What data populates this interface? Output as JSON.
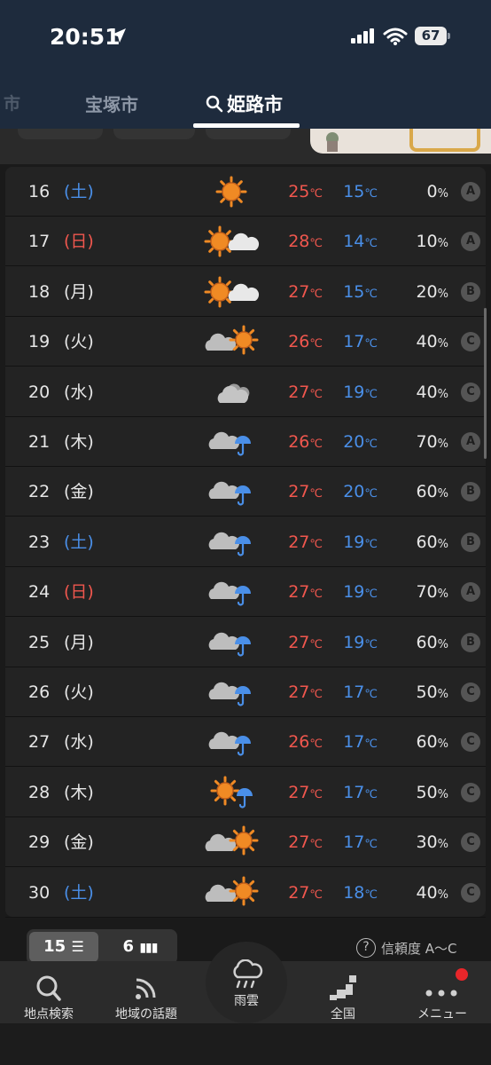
{
  "status_bar": {
    "time": "20:51",
    "battery": "67"
  },
  "tabs": {
    "prev_partial": "市",
    "other": "宝塚市",
    "active": "姫路市"
  },
  "colors": {
    "high": "#f0574e",
    "low": "#4a8fe8",
    "sun": "#f08a24",
    "rain": "#4a8fe8"
  },
  "forecast": [
    {
      "date": "16",
      "weekday": "(土)",
      "day_type": "sat",
      "icon": "sunny-icon",
      "high": "25",
      "low": "15",
      "unit": "℃",
      "pop": "0",
      "pct": "%",
      "reliability": "A"
    },
    {
      "date": "17",
      "weekday": "(日)",
      "day_type": "sun",
      "icon": "sunny-then-cloudy-icon",
      "high": "28",
      "low": "14",
      "unit": "℃",
      "pop": "10",
      "pct": "%",
      "reliability": "A"
    },
    {
      "date": "18",
      "weekday": "(月)",
      "day_type": "wkd",
      "icon": "sunny-then-cloudy-icon",
      "high": "27",
      "low": "15",
      "unit": "℃",
      "pop": "20",
      "pct": "%",
      "reliability": "B"
    },
    {
      "date": "19",
      "weekday": "(火)",
      "day_type": "wkd",
      "icon": "cloudy-then-sunny-icon",
      "high": "26",
      "low": "17",
      "unit": "℃",
      "pop": "40",
      "pct": "%",
      "reliability": "C"
    },
    {
      "date": "20",
      "weekday": "(水)",
      "day_type": "wkd",
      "icon": "cloudy-icon",
      "high": "27",
      "low": "19",
      "unit": "℃",
      "pop": "40",
      "pct": "%",
      "reliability": "C"
    },
    {
      "date": "21",
      "weekday": "(木)",
      "day_type": "wkd",
      "icon": "cloudy-then-rain-icon",
      "high": "26",
      "low": "20",
      "unit": "℃",
      "pop": "70",
      "pct": "%",
      "reliability": "A"
    },
    {
      "date": "22",
      "weekday": "(金)",
      "day_type": "wkd",
      "icon": "cloudy-then-rain-icon",
      "high": "27",
      "low": "20",
      "unit": "℃",
      "pop": "60",
      "pct": "%",
      "reliability": "B"
    },
    {
      "date": "23",
      "weekday": "(土)",
      "day_type": "sat",
      "icon": "cloudy-then-rain-icon",
      "high": "27",
      "low": "19",
      "unit": "℃",
      "pop": "60",
      "pct": "%",
      "reliability": "B"
    },
    {
      "date": "24",
      "weekday": "(日)",
      "day_type": "sun",
      "icon": "cloudy-then-rain-icon",
      "high": "27",
      "low": "19",
      "unit": "℃",
      "pop": "70",
      "pct": "%",
      "reliability": "A"
    },
    {
      "date": "25",
      "weekday": "(月)",
      "day_type": "wkd",
      "icon": "cloudy-then-rain-icon",
      "high": "27",
      "low": "19",
      "unit": "℃",
      "pop": "60",
      "pct": "%",
      "reliability": "B"
    },
    {
      "date": "26",
      "weekday": "(火)",
      "day_type": "wkd",
      "icon": "cloudy-then-rain-icon",
      "high": "27",
      "low": "17",
      "unit": "℃",
      "pop": "50",
      "pct": "%",
      "reliability": "C"
    },
    {
      "date": "27",
      "weekday": "(水)",
      "day_type": "wkd",
      "icon": "cloudy-then-rain-icon",
      "high": "26",
      "low": "17",
      "unit": "℃",
      "pop": "60",
      "pct": "%",
      "reliability": "C"
    },
    {
      "date": "28",
      "weekday": "(木)",
      "day_type": "wkd",
      "icon": "sunny-then-rain-icon",
      "high": "27",
      "low": "17",
      "unit": "℃",
      "pop": "50",
      "pct": "%",
      "reliability": "C"
    },
    {
      "date": "29",
      "weekday": "(金)",
      "day_type": "wkd",
      "icon": "cloudy-then-sunny-icon",
      "high": "27",
      "low": "17",
      "unit": "℃",
      "pop": "30",
      "pct": "%",
      "reliability": "C"
    },
    {
      "date": "30",
      "weekday": "(土)",
      "day_type": "sat",
      "icon": "cloudy-then-sunny-icon",
      "high": "27",
      "low": "18",
      "unit": "℃",
      "pop": "40",
      "pct": "%",
      "reliability": "C"
    }
  ],
  "toggle": {
    "days15": "15",
    "days6": "6"
  },
  "reliability_label": "信頼度 A〜C",
  "tabbar": {
    "search": "地点検索",
    "topics": "地域の話題",
    "rain": "雨雲",
    "national": "全国",
    "menu": "メニュー"
  }
}
